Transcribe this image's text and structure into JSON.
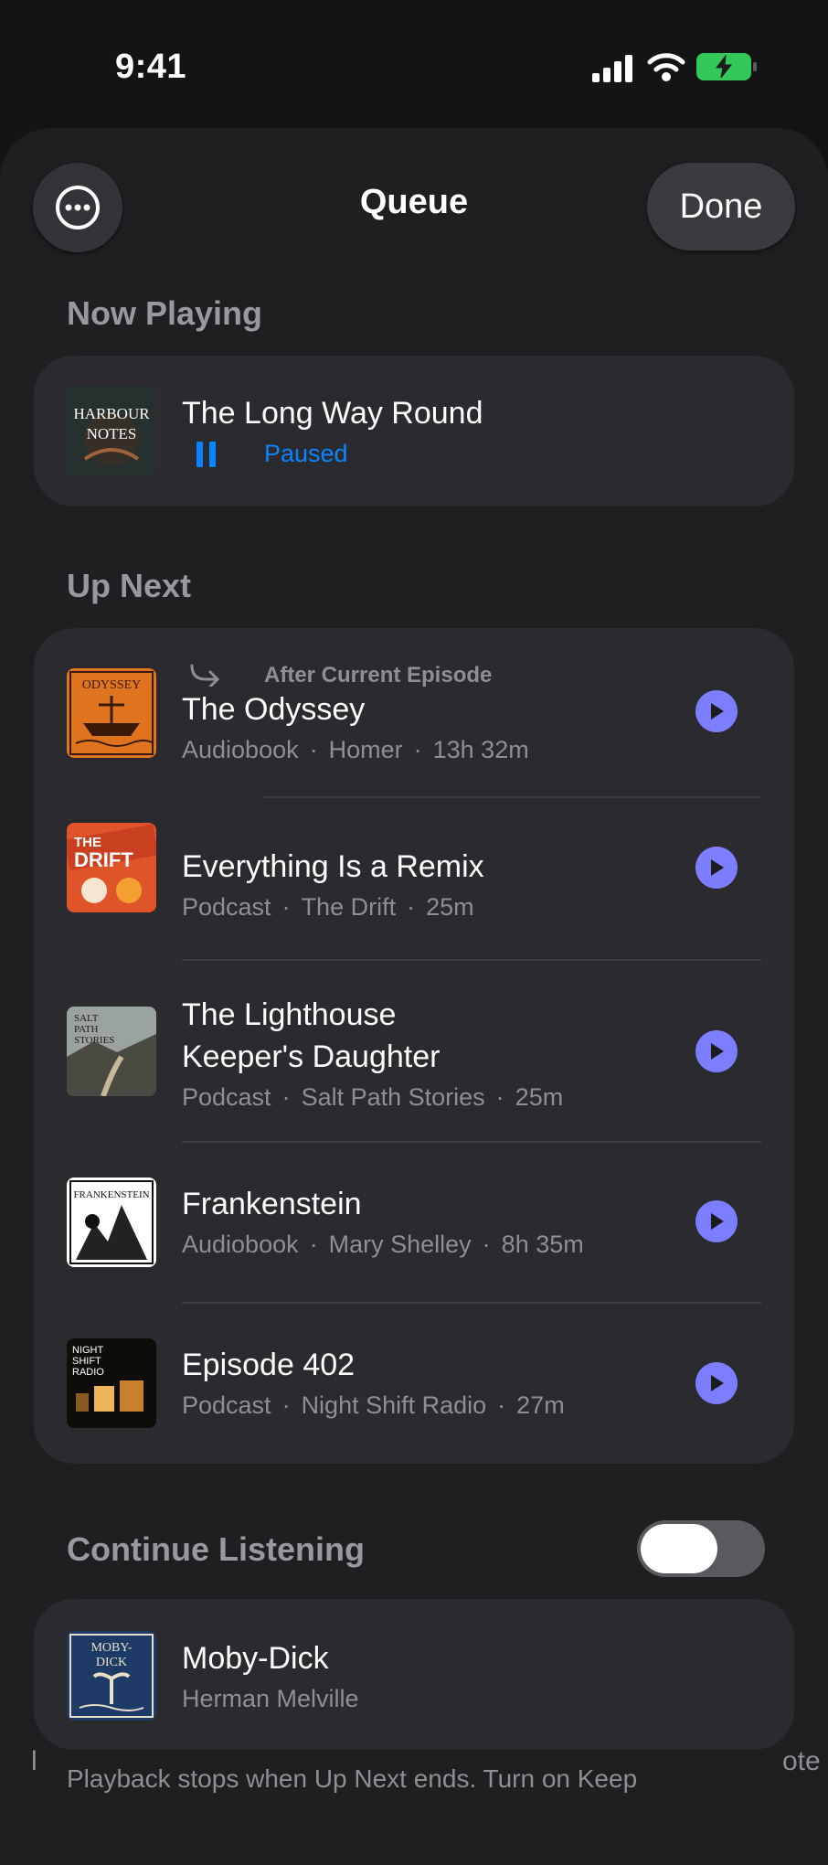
{
  "status": {
    "time": "9:41"
  },
  "header": {
    "title": "Queue",
    "done_label": "Done"
  },
  "now_playing": {
    "section_label": "Now Playing",
    "title": "The Long Way Round",
    "state": "Paused",
    "art_text": "HARBOUR NOTES"
  },
  "up_next": {
    "section_label": "Up Next",
    "after_current_label": "After Current Episode",
    "items": [
      {
        "title": "The Odyssey",
        "type": "Audiobook",
        "author": "Homer",
        "duration": "13h 32m",
        "art_text": "ODYSSEY"
      },
      {
        "title": "Everything Is a Remix",
        "type": "Podcast",
        "author": "The Drift",
        "duration": "25m",
        "art_text": "THE DRIFT"
      },
      {
        "title_line1": "The Lighthouse",
        "title_line2": "Keeper's Daughter",
        "type": "Podcast",
        "author": "Salt Path Stories",
        "duration": "25m",
        "art_text": "SALT PATH STORIES"
      },
      {
        "title": "Frankenstein",
        "type": "Audiobook",
        "author": "Mary Shelley",
        "duration": "8h 35m",
        "art_text": "FRANKENSTEIN"
      },
      {
        "title": "Episode 402",
        "type": "Podcast",
        "author": "Night Shift Radio",
        "duration": "27m",
        "art_text": "NIGHT SHIFT RADIO"
      }
    ]
  },
  "continue_listening": {
    "section_label": "Continue Listening",
    "toggle_on": false,
    "item": {
      "title": "Moby-Dick",
      "author": "Herman Melville",
      "art_text": "MOBY-DICK"
    },
    "footer_text": "Playback stops when Up Next ends. Turn on Keep",
    "edge_left": "l",
    "edge_right": "ote"
  },
  "separator": "·",
  "colors": {
    "accent": "#0a84ff",
    "play": "#7d7dff",
    "battery": "#34c759"
  }
}
